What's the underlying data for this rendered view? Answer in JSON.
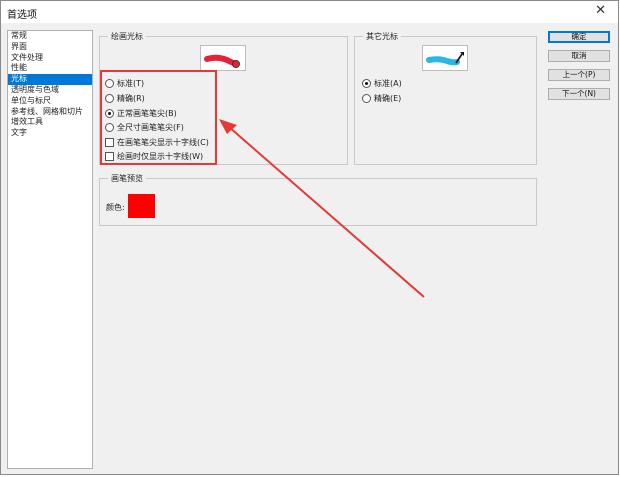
{
  "window": {
    "title": "首选项",
    "close_glyph": "✕"
  },
  "sidebar": {
    "items": [
      {
        "label": "常规"
      },
      {
        "label": "界面"
      },
      {
        "label": "文件处理"
      },
      {
        "label": "性能"
      },
      {
        "label": "光标",
        "active": true
      },
      {
        "label": "透明度与色域"
      },
      {
        "label": "单位与标尺"
      },
      {
        "label": "参考线、网格和切片"
      },
      {
        "label": "增效工具"
      },
      {
        "label": "文字"
      }
    ]
  },
  "painting_cursors": {
    "legend": "绘画光标",
    "options": [
      {
        "type": "radio",
        "label": "标准(T)",
        "checked": false
      },
      {
        "type": "radio",
        "label": "精确(R)",
        "checked": false
      },
      {
        "type": "radio",
        "label": "正常画笔笔尖(B)",
        "checked": true
      },
      {
        "type": "radio",
        "label": "全尺寸画笔笔尖(F)",
        "checked": false
      },
      {
        "type": "checkbox",
        "label": "在画笔笔尖显示十字线(C)",
        "checked": false
      },
      {
        "type": "checkbox",
        "label": "绘画时仅显示十字线(W)",
        "checked": false
      }
    ]
  },
  "other_cursors": {
    "legend": "其它光标",
    "options": [
      {
        "type": "radio",
        "label": "标准(A)",
        "checked": true
      },
      {
        "type": "radio",
        "label": "精确(E)",
        "checked": false
      }
    ]
  },
  "brush_preview": {
    "legend": "画笔预览",
    "color_label": "颜色:",
    "color": "#ff0000"
  },
  "buttons": {
    "ok": "确定",
    "cancel": "取消",
    "prev": "上一个(P)",
    "next": "下一个(N)"
  },
  "colors": {
    "highlight": "#0078d7",
    "annotation": "#e53935",
    "brush_stroke": "#e8203a",
    "cursor_stroke": "#29b6e8"
  }
}
